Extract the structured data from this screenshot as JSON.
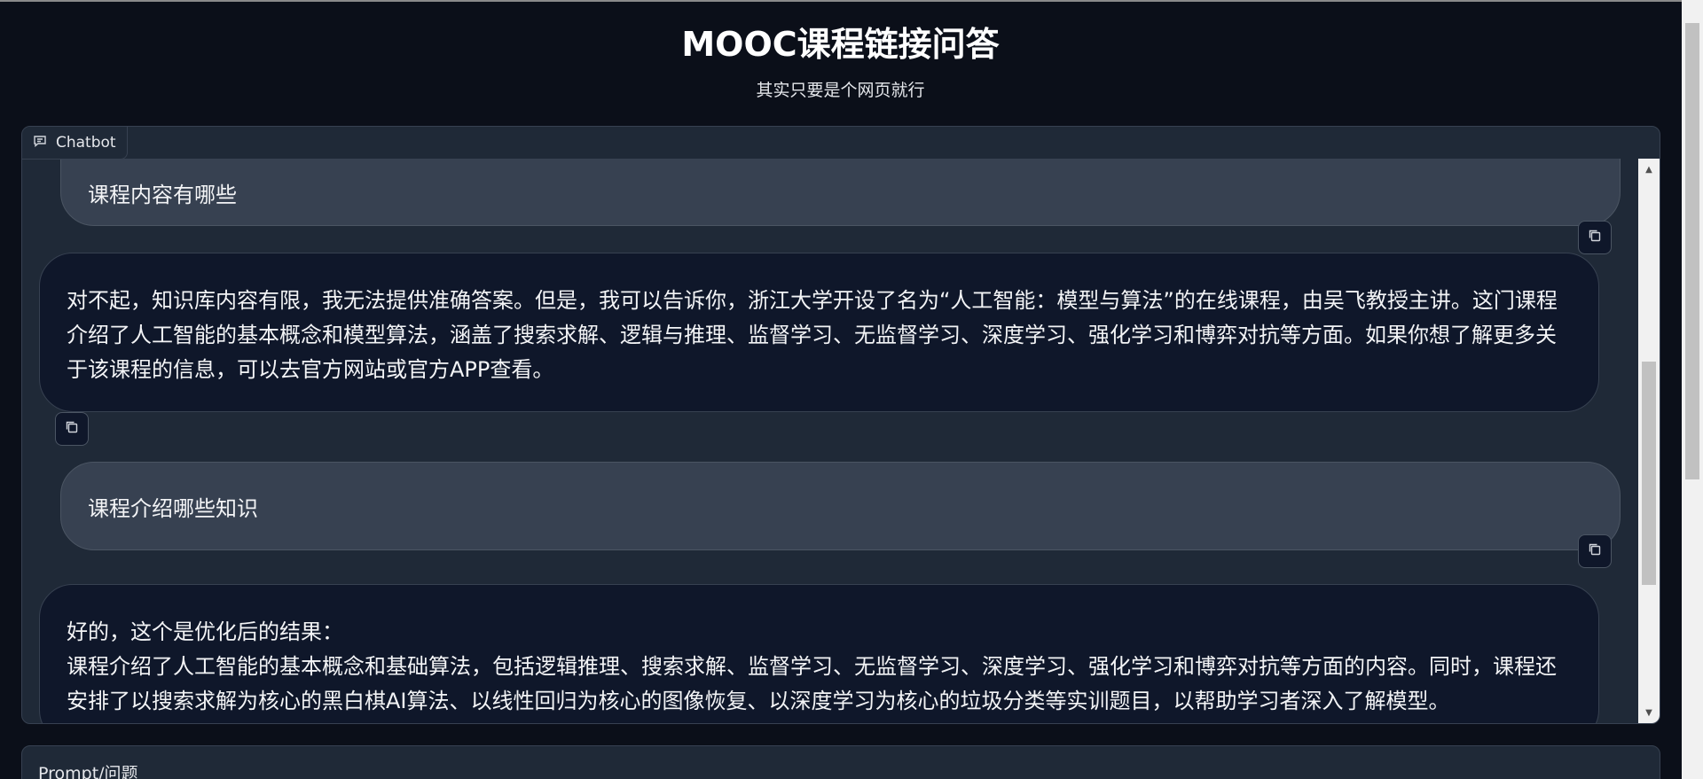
{
  "header": {
    "title": "MOOC课程链接问答",
    "subtitle": "其实只要是个网页就行"
  },
  "chatbot": {
    "label": "Chatbot",
    "messages": [
      {
        "role": "user",
        "text": "课程内容有哪些"
      },
      {
        "role": "bot",
        "text": "对不起，知识库内容有限，我无法提供准确答案。但是，我可以告诉你，浙江大学开设了名为“人工智能：模型与算法”的在线课程，由吴飞教授主讲。这门课程介绍了人工智能的基本概念和模型算法，涵盖了搜索求解、逻辑与推理、监督学习、无监督学习、深度学习、强化学习和博弈对抗等方面。如果你想了解更多关于该课程的信息，可以去官方网站或官方APP查看。"
      },
      {
        "role": "user",
        "text": "课程介绍哪些知识"
      },
      {
        "role": "bot",
        "text": "好的，这个是优化后的结果：\n课程介绍了人工智能的基本概念和基础算法，包括逻辑推理、搜索求解、监督学习、无监督学习、深度学习、强化学习和博弈对抗等方面的内容。同时，课程还安排了以搜索求解为核心的黑白棋AI算法、以线性回归为核心的图像恢复、以深度学习为核心的垃圾分类等实训题目，以帮助学习者深入了解模型。"
      }
    ]
  },
  "prompt": {
    "label": "Prompt/问题"
  },
  "icons": {
    "chat": "chat-bubble-icon",
    "copy": "copy-icon",
    "scroll_up": "arrow-up-icon",
    "scroll_down": "arrow-down-icon"
  },
  "colors": {
    "background": "#0b0f19",
    "panel": "#1f2937",
    "user_bubble": "#374151",
    "bot_bubble": "#0f172a"
  }
}
